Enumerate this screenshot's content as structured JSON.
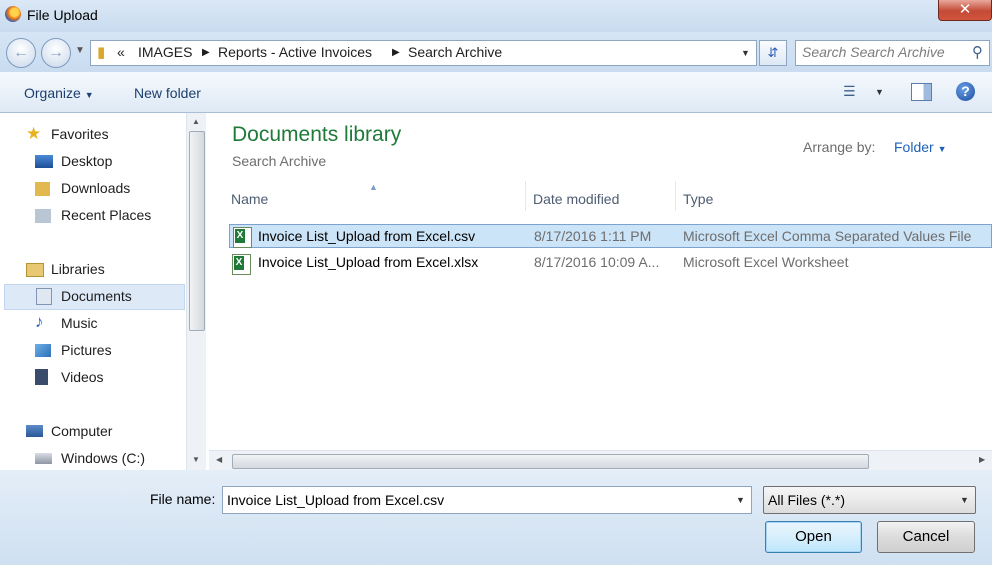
{
  "window": {
    "title": "File Upload",
    "close_label": "✕"
  },
  "address": {
    "overflow": "«",
    "crumbs": [
      "IMAGES",
      "Reports - Active Invoices",
      "Search Archive"
    ]
  },
  "search": {
    "placeholder": "Search Search Archive"
  },
  "toolbar": {
    "organize": "Organize",
    "new_folder": "New folder"
  },
  "navpane": {
    "favorites": "Favorites",
    "desktop": "Desktop",
    "downloads": "Downloads",
    "recent": "Recent Places",
    "libraries": "Libraries",
    "documents": "Documents",
    "music": "Music",
    "pictures": "Pictures",
    "videos": "Videos",
    "computer": "Computer",
    "windows_c": "Windows (C:)"
  },
  "content": {
    "library_title": "Documents library",
    "library_subtitle": "Search Archive",
    "arrange_label": "Arrange by:",
    "arrange_value": "Folder",
    "columns": {
      "name": "Name",
      "date": "Date modified",
      "type": "Type"
    },
    "files": [
      {
        "name": "Invoice List_Upload from Excel.csv",
        "date": "8/17/2016 1:11 PM",
        "type": "Microsoft Excel Comma Separated Values File"
      },
      {
        "name": "Invoice List_Upload from Excel.xlsx",
        "date": "8/17/2016 10:09 A...",
        "type": "Microsoft Excel Worksheet"
      }
    ]
  },
  "bottom": {
    "file_name_label": "File name:",
    "file_name_value": "Invoice List_Upload from Excel.csv",
    "filter_value": "All Files (*.*)",
    "open_label": "Open",
    "cancel_label": "Cancel"
  },
  "colors": {
    "accent": "#1f7a3a",
    "link": "#1e5fb8",
    "selection": "#cce4f7"
  }
}
